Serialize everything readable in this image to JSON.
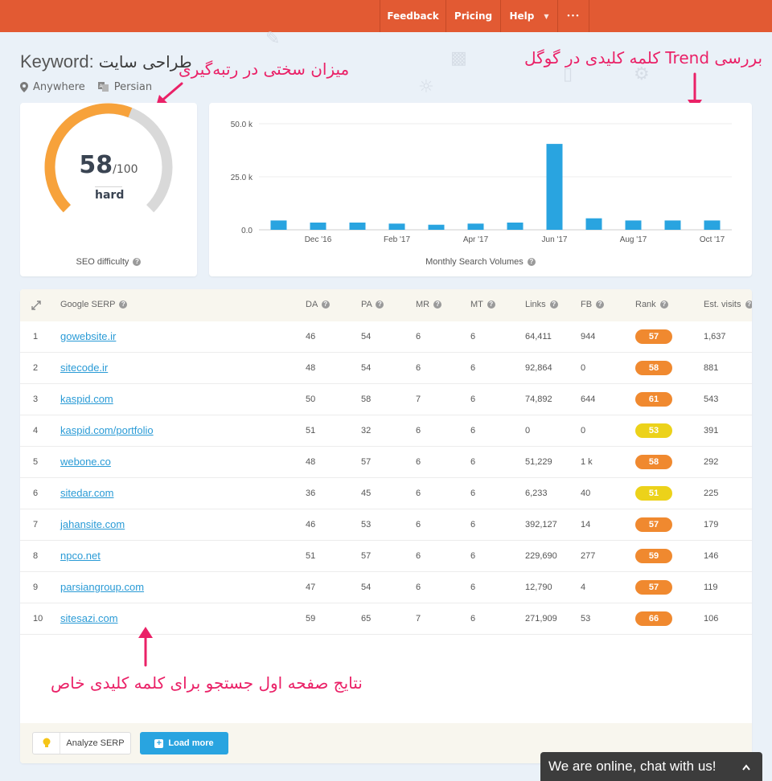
{
  "nav": {
    "feedback": "Feedback",
    "pricing": "Pricing",
    "help": "Help",
    "more": "•••"
  },
  "header": {
    "label": "Keyword:",
    "keyword": "طراحی سایت",
    "location": "Anywhere",
    "language": "Persian"
  },
  "annotations": {
    "difficulty": "میزان سختی در رتبه‌گیری",
    "trend": "بررسی Trend کلمه کلیدی در گوگل",
    "serp": "نتایج صفحه اول جستجو برای کلمه کلیدی خاص"
  },
  "gauge": {
    "score": 58,
    "score_text": "58",
    "max_text": "/100",
    "level": "hard",
    "caption": "SEO difficulty",
    "color_fill": "#f7a23b",
    "color_track": "#d9d9d9"
  },
  "chart_data": {
    "type": "bar",
    "title": "",
    "xlabel": "Monthly Search Volumes",
    "ylabel": "",
    "ylim": [
      0,
      50000
    ],
    "yticks": [
      "0.0",
      "25.0 k",
      "50.0 k"
    ],
    "ytick_values": [
      0,
      25000,
      50000
    ],
    "categories": [
      "Nov '16",
      "Dec '16",
      "Jan '17",
      "Feb '17",
      "Mar '17",
      "Apr '17",
      "May '17",
      "Jun '17",
      "Jul '17",
      "Aug '17",
      "Sep '17",
      "Oct '17"
    ],
    "xtick_labels": [
      "Dec '16",
      "Feb '17",
      "Apr '17",
      "Jun '17",
      "Aug '17",
      "Oct '17"
    ],
    "values": [
      4400,
      3400,
      3400,
      2900,
      2400,
      2900,
      3400,
      40500,
      5400,
      4400,
      4400,
      4400
    ],
    "color": "#29a4e0",
    "grid": true
  },
  "table": {
    "headers": {
      "serp": "Google SERP",
      "da": "DA",
      "pa": "PA",
      "mr": "MR",
      "mt": "MT",
      "links": "Links",
      "fb": "FB",
      "rank": "Rank",
      "visits": "Est. visits"
    },
    "rows": [
      {
        "n": "1",
        "url": "gowebsite.ir",
        "da": "46",
        "pa": "54",
        "mr": "6",
        "mt": "6",
        "links": "64,411",
        "fb": "944",
        "rank": "57",
        "rank_color": "#f0892f",
        "visits": "1,637"
      },
      {
        "n": "2",
        "url": "sitecode.ir",
        "da": "48",
        "pa": "54",
        "mr": "6",
        "mt": "6",
        "links": "92,864",
        "fb": "0",
        "rank": "58",
        "rank_color": "#f0892f",
        "visits": "881"
      },
      {
        "n": "3",
        "url": "kaspid.com",
        "da": "50",
        "pa": "58",
        "mr": "7",
        "mt": "6",
        "links": "74,892",
        "fb": "644",
        "rank": "61",
        "rank_color": "#f0892f",
        "visits": "543"
      },
      {
        "n": "4",
        "url": "kaspid.com/portfolio",
        "da": "51",
        "pa": "32",
        "mr": "6",
        "mt": "6",
        "links": "0",
        "fb": "0",
        "rank": "53",
        "rank_color": "#ecd21a",
        "visits": "391"
      },
      {
        "n": "5",
        "url": "webone.co",
        "da": "48",
        "pa": "57",
        "mr": "6",
        "mt": "6",
        "links": "51,229",
        "fb": "1 k",
        "rank": "58",
        "rank_color": "#f0892f",
        "visits": "292"
      },
      {
        "n": "6",
        "url": "sitedar.com",
        "da": "36",
        "pa": "45",
        "mr": "6",
        "mt": "6",
        "links": "6,233",
        "fb": "40",
        "rank": "51",
        "rank_color": "#ecd21a",
        "visits": "225"
      },
      {
        "n": "7",
        "url": "jahansite.com",
        "da": "46",
        "pa": "53",
        "mr": "6",
        "mt": "6",
        "links": "392,127",
        "fb": "14",
        "rank": "57",
        "rank_color": "#f0892f",
        "visits": "179"
      },
      {
        "n": "8",
        "url": "npco.net",
        "da": "51",
        "pa": "57",
        "mr": "6",
        "mt": "6",
        "links": "229,690",
        "fb": "277",
        "rank": "59",
        "rank_color": "#f0892f",
        "visits": "146"
      },
      {
        "n": "9",
        "url": "parsiangroup.com",
        "da": "47",
        "pa": "54",
        "mr": "6",
        "mt": "6",
        "links": "12,790",
        "fb": "4",
        "rank": "57",
        "rank_color": "#f0892f",
        "visits": "119"
      },
      {
        "n": "10",
        "url": "sitesazi.com",
        "da": "59",
        "pa": "65",
        "mr": "7",
        "mt": "6",
        "links": "271,909",
        "fb": "53",
        "rank": "66",
        "rank_color": "#f0892f",
        "visits": "106"
      }
    ]
  },
  "buttons": {
    "analyze": "Analyze SERP",
    "load_more": "Load more"
  },
  "chat": {
    "text": "We are online, chat with us!"
  },
  "icons": {
    "location": "map-pin-icon",
    "language": "translate-icon",
    "expand": "expand-icon",
    "help": "question-circle-icon",
    "chat_toggle": "chevron-up-icon"
  }
}
